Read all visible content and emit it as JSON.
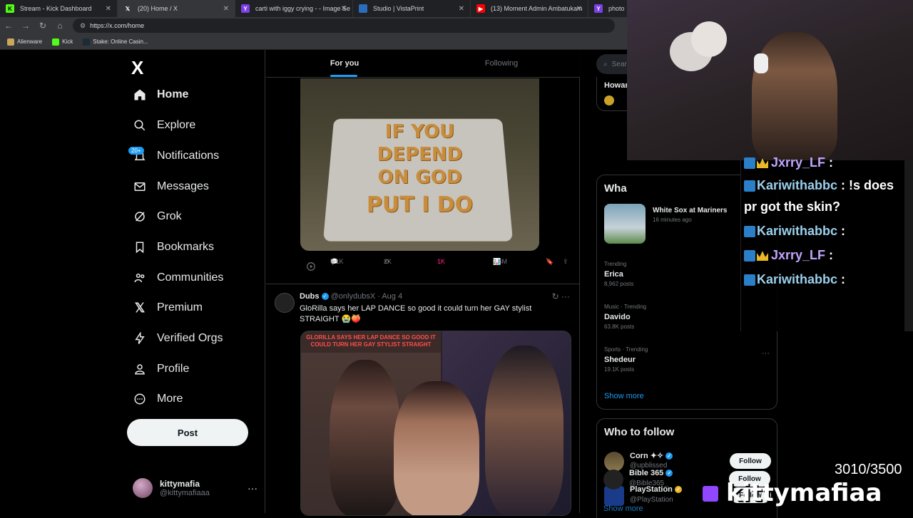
{
  "browser": {
    "tabs": [
      {
        "label": "Stream - Kick Dashboard",
        "color": "#53fc18"
      },
      {
        "label": "(20) Home / X",
        "color": "#ffffff"
      },
      {
        "label": "carti with iggy crying - - Image Se",
        "color": "#7b3fe4"
      },
      {
        "label": "Studio | VistaPrint",
        "color": "#2a6ebb"
      },
      {
        "label": "(13) Moment Admin Ambatukam",
        "color": "#ff0000"
      },
      {
        "label": "photope",
        "color": "#7b3fe4"
      }
    ],
    "url": "https://x.com/home",
    "bookmarks": [
      "Alienware",
      "Kick",
      "Stake: Online Casin..."
    ]
  },
  "sidebar": {
    "logo": "X",
    "items": [
      {
        "label": "Home",
        "icon": "home-icon",
        "active": true
      },
      {
        "label": "Explore",
        "icon": "search-icon"
      },
      {
        "label": "Notifications",
        "icon": "bell-icon",
        "badge": "20+"
      },
      {
        "label": "Messages",
        "icon": "mail-icon"
      },
      {
        "label": "Grok",
        "icon": "grok-icon"
      },
      {
        "label": "Bookmarks",
        "icon": "bookmark-icon"
      },
      {
        "label": "Communities",
        "icon": "people-icon"
      },
      {
        "label": "Premium",
        "icon": "x-icon"
      },
      {
        "label": "Verified Orgs",
        "icon": "bolt-icon"
      },
      {
        "label": "Profile",
        "icon": "person-icon"
      },
      {
        "label": "More",
        "icon": "more-icon"
      }
    ],
    "post_label": "Post",
    "account": {
      "name": "kittymafia",
      "handle": "@kittymafiaaa"
    }
  },
  "feed": {
    "tabs": [
      "For you",
      "Following"
    ],
    "tweet1": {
      "image_text": [
        "IF YOU",
        "DEPEND",
        "ON GOD",
        "PUT I DO"
      ],
      "replies": "5.1K",
      "reposts": "2K",
      "likes": "1K",
      "views": "2.4M"
    },
    "tweet2": {
      "name": "Dubs",
      "handle": "@onlydubsX",
      "date": "· Aug 4",
      "text": "GloRilla says her LAP DANCE so good it could turn her GAY stylist STRAIGHT 😭🍑",
      "image_caption": "GLORILLA SAYS HER LAP DANCE SO GOOD IT COULD TURN HER GAY STYLIST STRAIGHT"
    }
  },
  "right": {
    "search_placeholder": "Sear",
    "live_name": "Howar",
    "happening_title": "Wha",
    "event": {
      "title": "White Sox at Mariners",
      "time": "16 minutes ago"
    },
    "trends": [
      {
        "context": "Trending",
        "name": "Erica",
        "posts": "8,962 posts"
      },
      {
        "context": "Music · Trending",
        "name": "Davido",
        "posts": "63.8K posts"
      },
      {
        "context": "Sports · Trending",
        "name": "Shedeur",
        "posts": "19.1K posts"
      }
    ],
    "show_more": "Show more",
    "wtf_title": "Who to follow",
    "follow_label": "Follow",
    "suggestions": [
      {
        "name": "Corn ✦✧",
        "handle": "@upblissed",
        "verified": "blue"
      },
      {
        "name": "PlayStation",
        "handle": "@PlayStation",
        "verified": "gold"
      },
      {
        "name": "Bible 365",
        "handle": "@Bible365_",
        "verified": "blue"
      }
    ],
    "show_more2": "Show more"
  },
  "stream": {
    "chat": [
      {
        "user": "Jxrry_LF",
        "msg": ""
      },
      {
        "user": "Kariwithabbc",
        "msg": "!s does pr got the skin?"
      },
      {
        "user": "Kariwithabbc",
        "msg": ""
      },
      {
        "user": "Jxrry_LF",
        "msg": ""
      },
      {
        "user": "Kariwithabbc",
        "msg": ""
      }
    ],
    "goal": "3010/3500",
    "streamer_name": "kittymafiaa"
  }
}
